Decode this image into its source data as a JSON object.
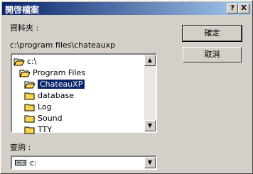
{
  "dialog": {
    "title": "開啓檔案",
    "help_label": "?",
    "close_label": "X"
  },
  "folder": {
    "label": "資料夾 :",
    "path": "c:\\program files\\chateauxp"
  },
  "tree": {
    "items": [
      {
        "label": "c:\\",
        "icon": "open-folder-icon"
      },
      {
        "label": "Program Files",
        "icon": "open-folder-icon"
      },
      {
        "label": "ChateauXP",
        "icon": "open-folder-icon",
        "selected": true
      },
      {
        "label": "database",
        "icon": "folder-icon"
      },
      {
        "label": "Log",
        "icon": "folder-icon"
      },
      {
        "label": "Sound",
        "icon": "folder-icon"
      },
      {
        "label": "TTY",
        "icon": "folder-icon"
      }
    ]
  },
  "drives": {
    "label": "查詢 :",
    "value": "c:",
    "icon": "drive-icon"
  },
  "buttons": {
    "ok": "確定",
    "cancel": "取消"
  },
  "colors": {
    "title_bar": "#0a246a",
    "selection": "#0a246a",
    "face": "#d4d0c8"
  }
}
